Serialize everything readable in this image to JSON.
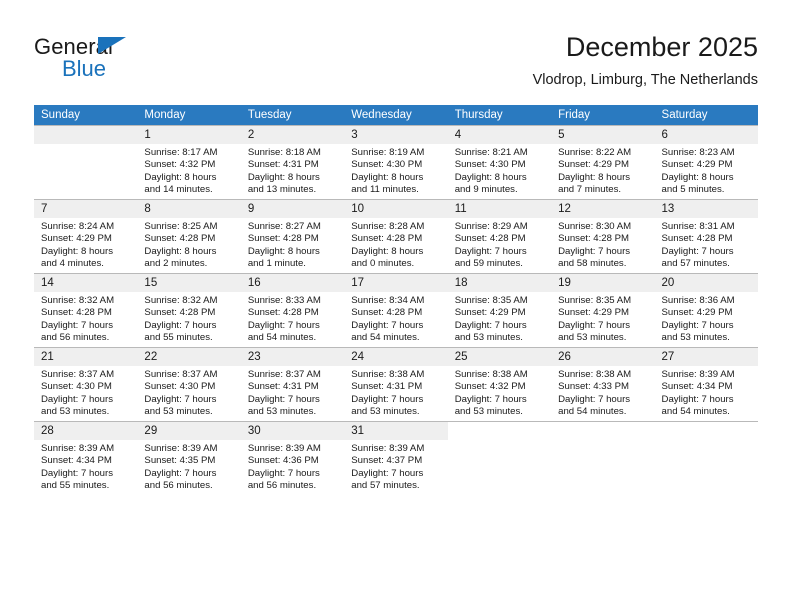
{
  "brand": {
    "name_top": "General",
    "name_bottom": "Blue",
    "triangle_color": "#1a72bb"
  },
  "header": {
    "title": "December 2025",
    "subtitle": "Vlodrop, Limburg, The Netherlands"
  },
  "colors": {
    "header_row": "#2a7ac0",
    "day_number_bg": "#efefef",
    "grid_line": "#b9b9b9",
    "text": "#1a1a1a"
  },
  "weekday_headers": [
    "Sunday",
    "Monday",
    "Tuesday",
    "Wednesday",
    "Thursday",
    "Friday",
    "Saturday"
  ],
  "weeks": [
    [
      {
        "day": "",
        "sunrise": "",
        "sunset": "",
        "daylight1": "",
        "daylight2": ""
      },
      {
        "day": "1",
        "sunrise": "Sunrise: 8:17 AM",
        "sunset": "Sunset: 4:32 PM",
        "daylight1": "Daylight: 8 hours",
        "daylight2": "and 14 minutes."
      },
      {
        "day": "2",
        "sunrise": "Sunrise: 8:18 AM",
        "sunset": "Sunset: 4:31 PM",
        "daylight1": "Daylight: 8 hours",
        "daylight2": "and 13 minutes."
      },
      {
        "day": "3",
        "sunrise": "Sunrise: 8:19 AM",
        "sunset": "Sunset: 4:30 PM",
        "daylight1": "Daylight: 8 hours",
        "daylight2": "and 11 minutes."
      },
      {
        "day": "4",
        "sunrise": "Sunrise: 8:21 AM",
        "sunset": "Sunset: 4:30 PM",
        "daylight1": "Daylight: 8 hours",
        "daylight2": "and 9 minutes."
      },
      {
        "day": "5",
        "sunrise": "Sunrise: 8:22 AM",
        "sunset": "Sunset: 4:29 PM",
        "daylight1": "Daylight: 8 hours",
        "daylight2": "and 7 minutes."
      },
      {
        "day": "6",
        "sunrise": "Sunrise: 8:23 AM",
        "sunset": "Sunset: 4:29 PM",
        "daylight1": "Daylight: 8 hours",
        "daylight2": "and 5 minutes."
      }
    ],
    [
      {
        "day": "7",
        "sunrise": "Sunrise: 8:24 AM",
        "sunset": "Sunset: 4:29 PM",
        "daylight1": "Daylight: 8 hours",
        "daylight2": "and 4 minutes."
      },
      {
        "day": "8",
        "sunrise": "Sunrise: 8:25 AM",
        "sunset": "Sunset: 4:28 PM",
        "daylight1": "Daylight: 8 hours",
        "daylight2": "and 2 minutes."
      },
      {
        "day": "9",
        "sunrise": "Sunrise: 8:27 AM",
        "sunset": "Sunset: 4:28 PM",
        "daylight1": "Daylight: 8 hours",
        "daylight2": "and 1 minute."
      },
      {
        "day": "10",
        "sunrise": "Sunrise: 8:28 AM",
        "sunset": "Sunset: 4:28 PM",
        "daylight1": "Daylight: 8 hours",
        "daylight2": "and 0 minutes."
      },
      {
        "day": "11",
        "sunrise": "Sunrise: 8:29 AM",
        "sunset": "Sunset: 4:28 PM",
        "daylight1": "Daylight: 7 hours",
        "daylight2": "and 59 minutes."
      },
      {
        "day": "12",
        "sunrise": "Sunrise: 8:30 AM",
        "sunset": "Sunset: 4:28 PM",
        "daylight1": "Daylight: 7 hours",
        "daylight2": "and 58 minutes."
      },
      {
        "day": "13",
        "sunrise": "Sunrise: 8:31 AM",
        "sunset": "Sunset: 4:28 PM",
        "daylight1": "Daylight: 7 hours",
        "daylight2": "and 57 minutes."
      }
    ],
    [
      {
        "day": "14",
        "sunrise": "Sunrise: 8:32 AM",
        "sunset": "Sunset: 4:28 PM",
        "daylight1": "Daylight: 7 hours",
        "daylight2": "and 56 minutes."
      },
      {
        "day": "15",
        "sunrise": "Sunrise: 8:32 AM",
        "sunset": "Sunset: 4:28 PM",
        "daylight1": "Daylight: 7 hours",
        "daylight2": "and 55 minutes."
      },
      {
        "day": "16",
        "sunrise": "Sunrise: 8:33 AM",
        "sunset": "Sunset: 4:28 PM",
        "daylight1": "Daylight: 7 hours",
        "daylight2": "and 54 minutes."
      },
      {
        "day": "17",
        "sunrise": "Sunrise: 8:34 AM",
        "sunset": "Sunset: 4:28 PM",
        "daylight1": "Daylight: 7 hours",
        "daylight2": "and 54 minutes."
      },
      {
        "day": "18",
        "sunrise": "Sunrise: 8:35 AM",
        "sunset": "Sunset: 4:29 PM",
        "daylight1": "Daylight: 7 hours",
        "daylight2": "and 53 minutes."
      },
      {
        "day": "19",
        "sunrise": "Sunrise: 8:35 AM",
        "sunset": "Sunset: 4:29 PM",
        "daylight1": "Daylight: 7 hours",
        "daylight2": "and 53 minutes."
      },
      {
        "day": "20",
        "sunrise": "Sunrise: 8:36 AM",
        "sunset": "Sunset: 4:29 PM",
        "daylight1": "Daylight: 7 hours",
        "daylight2": "and 53 minutes."
      }
    ],
    [
      {
        "day": "21",
        "sunrise": "Sunrise: 8:37 AM",
        "sunset": "Sunset: 4:30 PM",
        "daylight1": "Daylight: 7 hours",
        "daylight2": "and 53 minutes."
      },
      {
        "day": "22",
        "sunrise": "Sunrise: 8:37 AM",
        "sunset": "Sunset: 4:30 PM",
        "daylight1": "Daylight: 7 hours",
        "daylight2": "and 53 minutes."
      },
      {
        "day": "23",
        "sunrise": "Sunrise: 8:37 AM",
        "sunset": "Sunset: 4:31 PM",
        "daylight1": "Daylight: 7 hours",
        "daylight2": "and 53 minutes."
      },
      {
        "day": "24",
        "sunrise": "Sunrise: 8:38 AM",
        "sunset": "Sunset: 4:31 PM",
        "daylight1": "Daylight: 7 hours",
        "daylight2": "and 53 minutes."
      },
      {
        "day": "25",
        "sunrise": "Sunrise: 8:38 AM",
        "sunset": "Sunset: 4:32 PM",
        "daylight1": "Daylight: 7 hours",
        "daylight2": "and 53 minutes."
      },
      {
        "day": "26",
        "sunrise": "Sunrise: 8:38 AM",
        "sunset": "Sunset: 4:33 PM",
        "daylight1": "Daylight: 7 hours",
        "daylight2": "and 54 minutes."
      },
      {
        "day": "27",
        "sunrise": "Sunrise: 8:39 AM",
        "sunset": "Sunset: 4:34 PM",
        "daylight1": "Daylight: 7 hours",
        "daylight2": "and 54 minutes."
      }
    ],
    [
      {
        "day": "28",
        "sunrise": "Sunrise: 8:39 AM",
        "sunset": "Sunset: 4:34 PM",
        "daylight1": "Daylight: 7 hours",
        "daylight2": "and 55 minutes."
      },
      {
        "day": "29",
        "sunrise": "Sunrise: 8:39 AM",
        "sunset": "Sunset: 4:35 PM",
        "daylight1": "Daylight: 7 hours",
        "daylight2": "and 56 minutes."
      },
      {
        "day": "30",
        "sunrise": "Sunrise: 8:39 AM",
        "sunset": "Sunset: 4:36 PM",
        "daylight1": "Daylight: 7 hours",
        "daylight2": "and 56 minutes."
      },
      {
        "day": "31",
        "sunrise": "Sunrise: 8:39 AM",
        "sunset": "Sunset: 4:37 PM",
        "daylight1": "Daylight: 7 hours",
        "daylight2": "and 57 minutes."
      },
      {
        "day": "",
        "sunrise": "",
        "sunset": "",
        "daylight1": "",
        "daylight2": ""
      },
      {
        "day": "",
        "sunrise": "",
        "sunset": "",
        "daylight1": "",
        "daylight2": ""
      },
      {
        "day": "",
        "sunrise": "",
        "sunset": "",
        "daylight1": "",
        "daylight2": ""
      }
    ]
  ]
}
